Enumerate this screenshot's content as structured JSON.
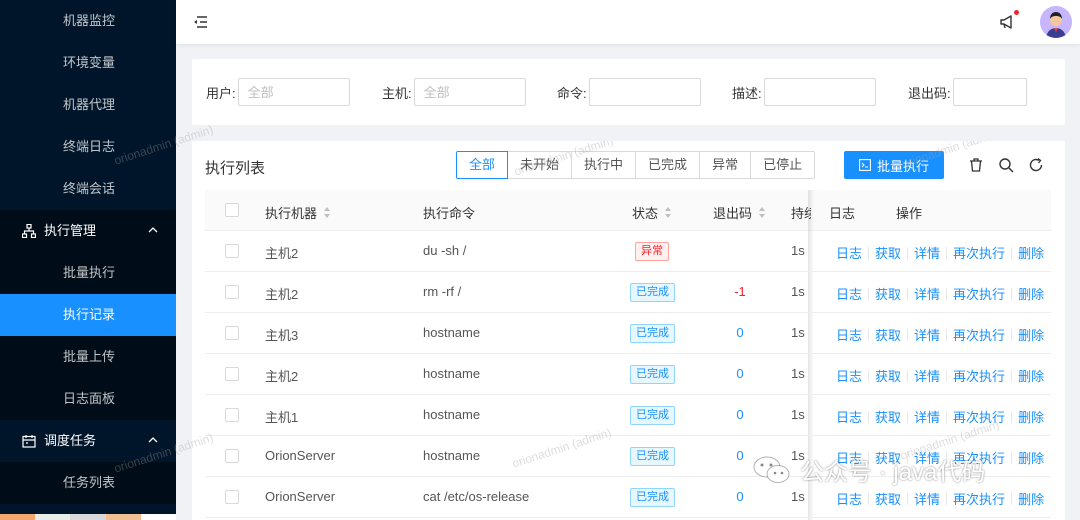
{
  "sidebar": {
    "top_items": [
      "机器监控",
      "环境变量",
      "机器代理",
      "终端日志",
      "终端会话"
    ],
    "group_exec": "执行管理",
    "exec_items": [
      "批量执行",
      "执行记录",
      "批量上传",
      "日志面板"
    ],
    "group_schedule": "调度任务",
    "schedule_items": [
      "任务列表"
    ]
  },
  "search": {
    "user_label": "用户:",
    "user_placeholder": "全部",
    "host_label": "主机:",
    "host_placeholder": "全部",
    "command_label": "命令:",
    "desc_label": "描述:",
    "exit_code_label": "退出码:"
  },
  "table_card": {
    "title": "执行列表",
    "filter_tabs": [
      "全部",
      "未开始",
      "执行中",
      "已完成",
      "异常",
      "已停止"
    ],
    "selected_filter": "全部",
    "batch_button": "批量执行"
  },
  "columns": {
    "machine": "执行机器",
    "command": "执行命令",
    "status": "状态",
    "exit_code": "退出码",
    "duration": "持续",
    "log": "日志",
    "actions": "操作"
  },
  "rows": [
    {
      "machine": "主机2",
      "command": "du -sh /",
      "status": "异常",
      "status_kind": "err",
      "exit_code": "",
      "duration": "1s"
    },
    {
      "machine": "主机2",
      "command": "rm -rf /",
      "status": "已完成",
      "status_kind": "done",
      "exit_code": "-1",
      "duration": "1s"
    },
    {
      "machine": "主机3",
      "command": "hostname",
      "status": "已完成",
      "status_kind": "done",
      "exit_code": "0",
      "duration": "1s"
    },
    {
      "machine": "主机2",
      "command": "hostname",
      "status": "已完成",
      "status_kind": "done",
      "exit_code": "0",
      "duration": "1s"
    },
    {
      "machine": "主机1",
      "command": "hostname",
      "status": "已完成",
      "status_kind": "done",
      "exit_code": "0",
      "duration": "1s"
    },
    {
      "machine": "OrionServer",
      "command": "hostname",
      "status": "已完成",
      "status_kind": "done",
      "exit_code": "0",
      "duration": "1s"
    },
    {
      "machine": "OrionServer",
      "command": "cat /etc/os-release",
      "status": "已完成",
      "status_kind": "done",
      "exit_code": "0",
      "duration": "1s"
    }
  ],
  "row_actions": [
    "日志",
    "获取",
    "详情",
    "再次执行",
    "删除"
  ],
  "watermark": "orionadmin (admin)",
  "overlay_text": "公众号 · java代码",
  "colors": {
    "primary": "#1890ff",
    "sidebar_bg": "#001529",
    "danger": "#f5222d"
  }
}
